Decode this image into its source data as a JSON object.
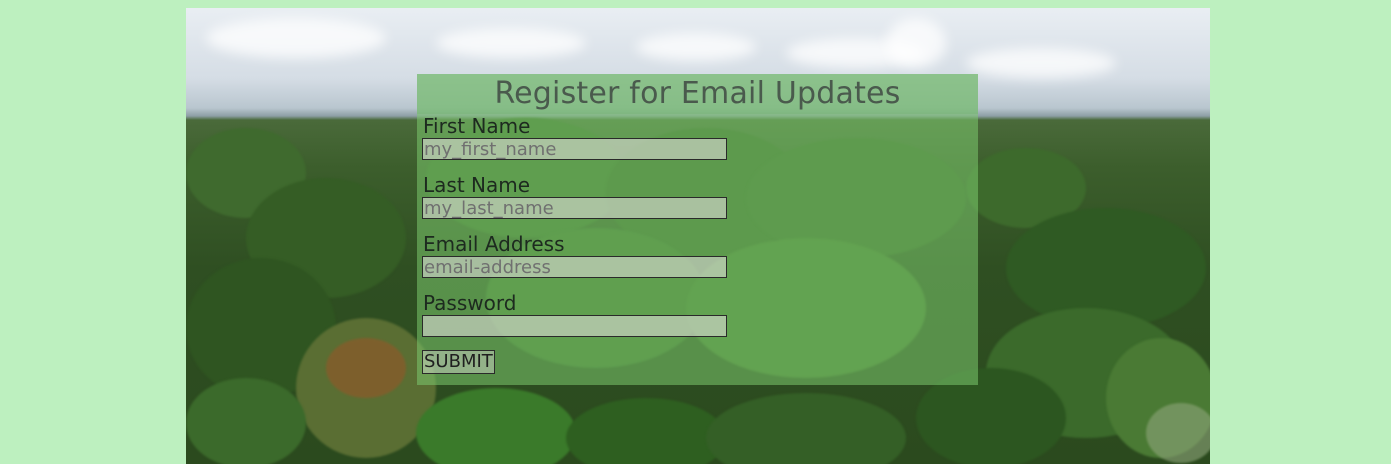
{
  "form": {
    "title": "Register for Email Updates",
    "fields": [
      {
        "label": "First Name",
        "placeholder": "my_first_name",
        "value": ""
      },
      {
        "label": "Last Name",
        "placeholder": "my_last_name",
        "value": ""
      },
      {
        "label": "Email Address",
        "placeholder": "email-address",
        "value": ""
      },
      {
        "label": "Password",
        "placeholder": "",
        "value": ""
      }
    ],
    "submit_label": "SUBMIT"
  },
  "colors": {
    "page_background": "#bdf0bf",
    "panel_overlay": "rgba(124,200,110,0.55)",
    "title_text": "#4a5a4d"
  }
}
